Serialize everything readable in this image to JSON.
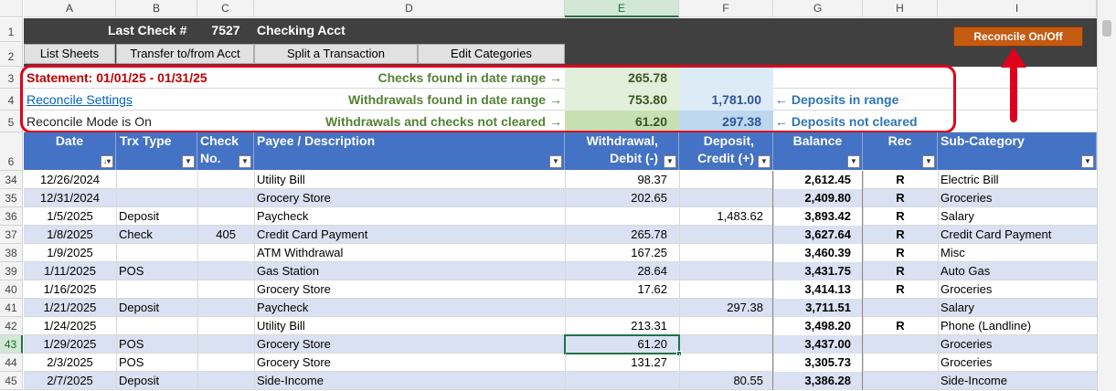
{
  "columns": [
    "A",
    "B",
    "C",
    "D",
    "E",
    "F",
    "G",
    "H",
    "I"
  ],
  "selected_column": "E",
  "header": {
    "last_check_label": "Last Check #",
    "last_check_value": "7527",
    "account_name": "Checking Acct",
    "reconcile_button": "Reconcile On/Off"
  },
  "toolbar": {
    "list_sheets": "List Sheets",
    "transfer": "Transfer to/from Acct",
    "split": "Split a Transaction",
    "edit_categories": "Edit Categories"
  },
  "summary": {
    "statement": "Statement: 01/01/25 - 01/31/25",
    "reconcile_settings": "Reconcile Settings",
    "mode": "Reconcile Mode is On",
    "checks_label": "Checks found in date range →",
    "checks_value": "265.78",
    "withdrawals_label": "Withdrawals found in date range →",
    "withdrawals_value": "753.80",
    "deposits_value": "1,781.00",
    "deposits_label": "← Deposits in range",
    "not_cleared_label": "Withdrawals and checks not cleared →",
    "not_cleared_value": "61.20",
    "deposits_not_cleared_value": "297.38",
    "deposits_not_cleared_label": "← Deposits not cleared"
  },
  "table": {
    "headers": {
      "date": "Date",
      "trx_type": "Trx Type",
      "check_no_1": "Check",
      "check_no_2": "No.",
      "payee": "Payee / Description",
      "withdrawal_1": "Withdrawal,",
      "withdrawal_2": "Debit (-)",
      "deposit_1": "Deposit,",
      "deposit_2": "Credit (+)",
      "balance": "Balance",
      "rec": "Rec",
      "subcategory": "Sub-Category"
    },
    "rows": [
      {
        "row": "34",
        "date": "12/26/2024",
        "type": "",
        "check": "",
        "payee": "Utility Bill",
        "withdrawal": "98.37",
        "deposit": "",
        "balance": "2,612.45",
        "rec": "R",
        "category": "Electric Bill"
      },
      {
        "row": "35",
        "date": "12/31/2024",
        "type": "",
        "check": "",
        "payee": "Grocery Store",
        "withdrawal": "202.65",
        "deposit": "",
        "balance": "2,409.80",
        "rec": "R",
        "category": "Groceries"
      },
      {
        "row": "36",
        "date": "1/5/2025",
        "type": "Deposit",
        "check": "",
        "payee": "Paycheck",
        "withdrawal": "",
        "deposit": "1,483.62",
        "balance": "3,893.42",
        "rec": "R",
        "category": "Salary"
      },
      {
        "row": "37",
        "date": "1/8/2025",
        "type": "Check",
        "check": "405",
        "payee": "Credit Card Payment",
        "withdrawal": "265.78",
        "deposit": "",
        "balance": "3,627.64",
        "rec": "R",
        "category": "Credit Card Payment"
      },
      {
        "row": "38",
        "date": "1/9/2025",
        "type": "",
        "check": "",
        "payee": "ATM Withdrawal",
        "withdrawal": "167.25",
        "deposit": "",
        "balance": "3,460.39",
        "rec": "R",
        "category": "Misc"
      },
      {
        "row": "39",
        "date": "1/11/2025",
        "type": "POS",
        "check": "",
        "payee": "Gas Station",
        "withdrawal": "28.64",
        "deposit": "",
        "balance": "3,431.75",
        "rec": "R",
        "category": "Auto Gas"
      },
      {
        "row": "40",
        "date": "1/16/2025",
        "type": "",
        "check": "",
        "payee": "Grocery Store",
        "withdrawal": "17.62",
        "deposit": "",
        "balance": "3,414.13",
        "rec": "R",
        "category": "Groceries"
      },
      {
        "row": "41",
        "date": "1/21/2025",
        "type": "Deposit",
        "check": "",
        "payee": "Paycheck",
        "withdrawal": "",
        "deposit": "297.38",
        "balance": "3,711.51",
        "rec": "",
        "category": "Salary"
      },
      {
        "row": "42",
        "date": "1/24/2025",
        "type": "",
        "check": "",
        "payee": "Utility Bill",
        "withdrawal": "213.31",
        "deposit": "",
        "balance": "3,498.20",
        "rec": "R",
        "category": "Phone (Landline)"
      },
      {
        "row": "43",
        "date": "1/29/2025",
        "type": "POS",
        "check": "",
        "payee": "Grocery Store",
        "withdrawal": "61.20",
        "deposit": "",
        "balance": "3,437.00",
        "rec": "",
        "category": "Groceries"
      },
      {
        "row": "44",
        "date": "2/3/2025",
        "type": "POS",
        "check": "",
        "payee": "Grocery Store",
        "withdrawal": "131.27",
        "deposit": "",
        "balance": "3,305.73",
        "rec": "",
        "category": "Groceries"
      },
      {
        "row": "45",
        "date": "2/7/2025",
        "type": "Deposit",
        "check": "",
        "payee": "Side-Income",
        "withdrawal": "",
        "deposit": "80.55",
        "balance": "3,386.28",
        "rec": "",
        "category": "Side-Income"
      }
    ]
  },
  "row_numbers_top": [
    "1",
    "2",
    "3",
    "4",
    "5",
    "6"
  ],
  "selected_row": "43",
  "colors": {
    "header_dark": "#404040",
    "table_header": "#4472c4",
    "band": "#d9e1f2",
    "highlight_border": "#e0001b",
    "reconcile_button": "#c55a11"
  }
}
